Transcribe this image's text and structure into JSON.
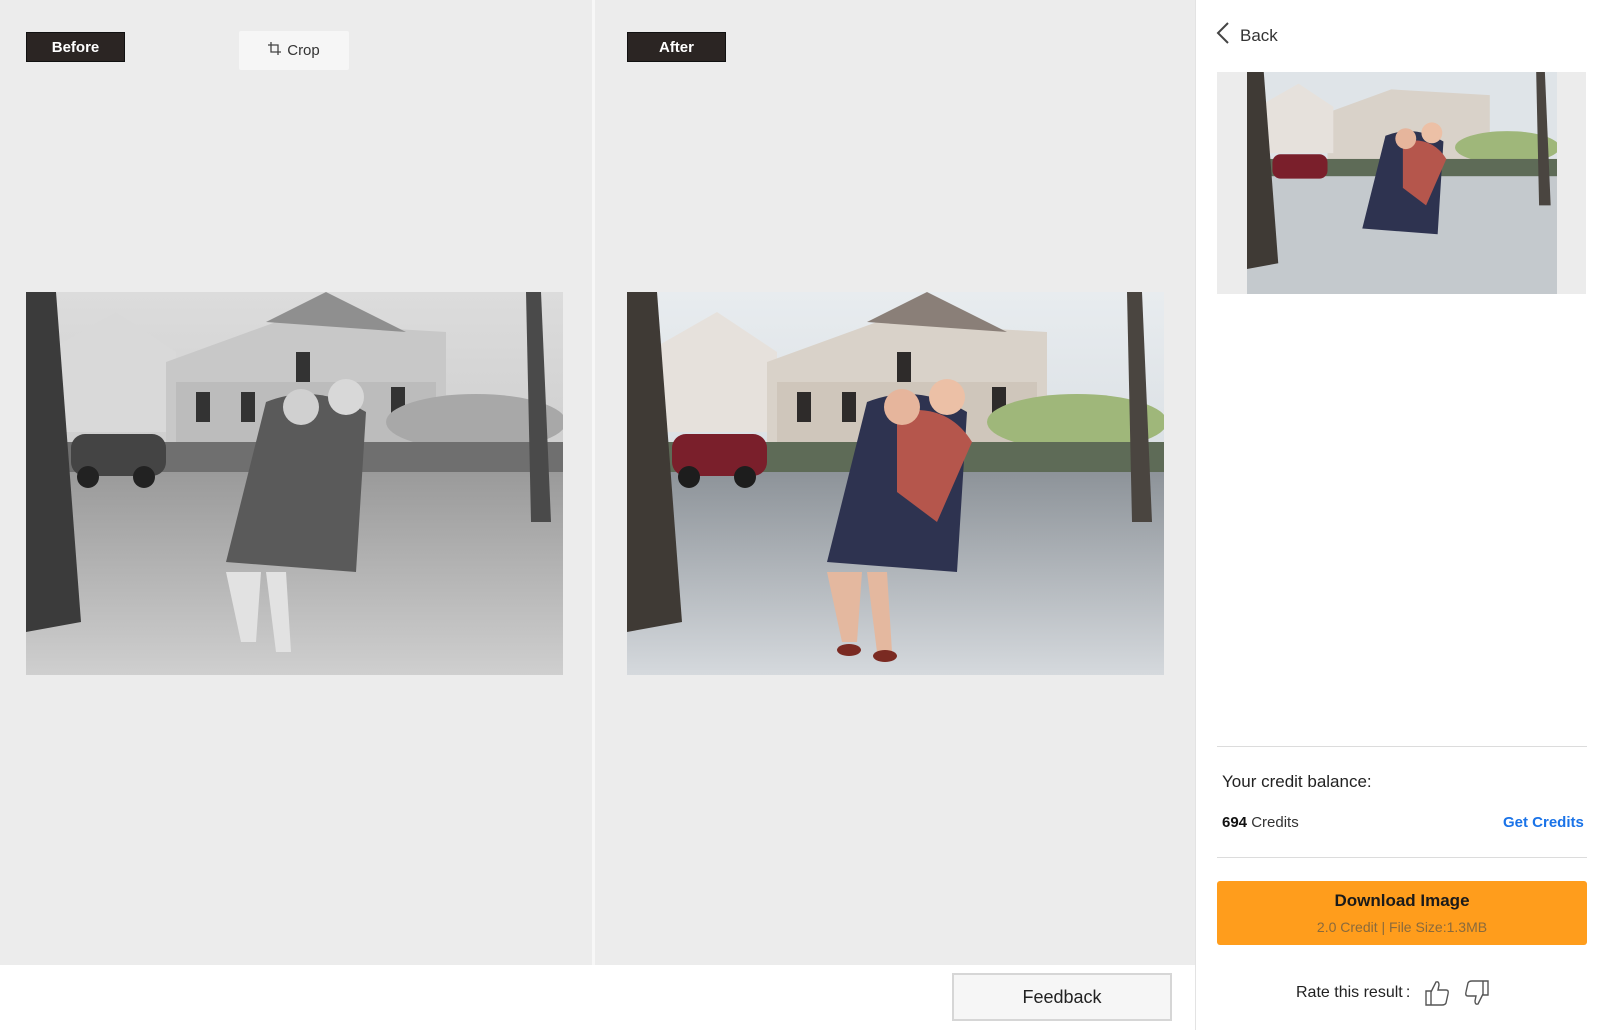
{
  "before_pane": {
    "label": "Before",
    "crop_label": "Crop"
  },
  "after_pane": {
    "label": "After"
  },
  "feedback": {
    "label": "Feedback"
  },
  "sidebar": {
    "back_label": "Back",
    "credit_title": "Your credit balance:",
    "credit_amount": "694",
    "credit_unit": "Credits",
    "get_credits_label": "Get Credits",
    "download": {
      "label": "Download Image",
      "sub": "2.0 Credit | File Size:1.3MB"
    },
    "rate_label": "Rate this result :"
  },
  "colors": {
    "accent_orange": "#ff9d1c",
    "link_blue": "#1a73e8",
    "tag_dark": "#2b2523"
  },
  "icons": [
    "crop-icon",
    "chevron-left-icon",
    "thumbs-up-icon",
    "thumbs-down-icon"
  ]
}
